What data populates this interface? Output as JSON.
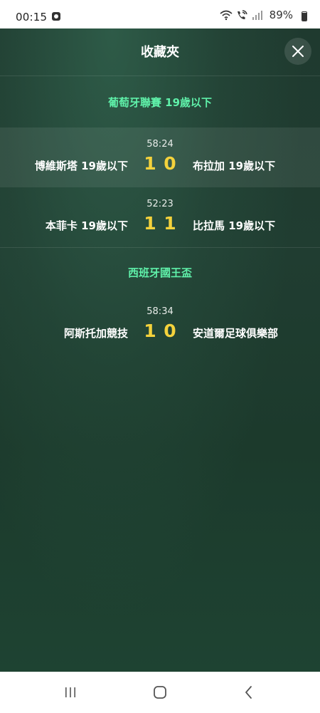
{
  "status_bar": {
    "time": "00:15",
    "battery_percent": "89%",
    "battery_level": 0.89,
    "icons": [
      "app-notification-icon",
      "wifi-icon",
      "wifi-calling-icon",
      "signal-icon",
      "battery-icon"
    ]
  },
  "header": {
    "title": "收藏夾",
    "close_icon": "close-icon"
  },
  "leagues": [
    {
      "name": "葡萄牙聯賽 19歲以下",
      "matches": [
        {
          "time": "58:24",
          "home": "博維斯塔 19歲以下",
          "home_score": "1",
          "away_score": "0",
          "away": "布拉加 19歲以下"
        },
        {
          "time": "52:23",
          "home": "本菲卡 19歲以下",
          "home_score": "1",
          "away_score": "1",
          "away": "比拉馬 19歲以下"
        }
      ]
    },
    {
      "name": "西班牙國王盃",
      "matches": [
        {
          "time": "58:34",
          "home": "阿斯托加競技",
          "home_score": "1",
          "away_score": "0",
          "away": "安道爾足球俱樂部"
        }
      ]
    }
  ],
  "colors": {
    "league_name": "#5ff0a9",
    "score": "#f4d23c",
    "background": "#1f3a2f"
  },
  "nav": {
    "recent_apps_icon": "recent-apps-icon",
    "home_icon": "home-icon",
    "back_icon": "back-icon"
  }
}
